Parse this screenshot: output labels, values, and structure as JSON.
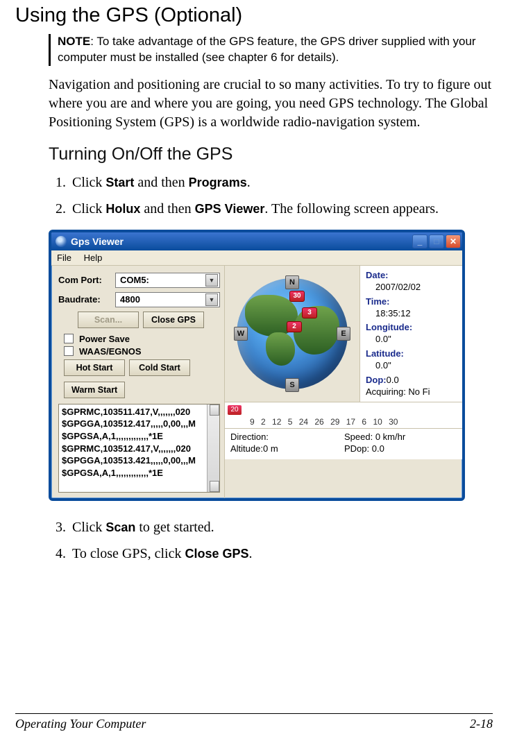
{
  "doc": {
    "h1": "Using the GPS (Optional)",
    "note_label": "NOTE",
    "note_text": ": To take advantage of the GPS feature, the GPS driver supplied with your computer must be installed (see chapter 6 for details).",
    "para1": "Navigation and positioning are crucial to so many activities. To try to figure out where you are and where you are going, you need GPS technology. The Global Positioning System (GPS) is a worldwide radio-navigation system.",
    "h2": "Turning On/Off the GPS",
    "step1_a": "Click ",
    "step1_b": "Start",
    "step1_c": " and then ",
    "step1_d": "Programs",
    "step1_e": ".",
    "step2_a": "Click ",
    "step2_b": "Holux",
    "step2_c": " and then ",
    "step2_d": "GPS Viewer",
    "step2_e": ". The following screen appears.",
    "step3_a": "Click ",
    "step3_b": "Scan",
    "step3_c": " to get started.",
    "step4_a": "To close GPS, click ",
    "step4_b": "Close GPS",
    "step4_c": ".",
    "footer_left": "Operating Your Computer",
    "footer_right": "2-18"
  },
  "app": {
    "title": "Gps Viewer",
    "menu": {
      "file": "File",
      "help": "Help"
    },
    "labels": {
      "comport": "Com Port:",
      "baudrate": "Baudrate:",
      "scan": "Scan...",
      "close_gps": "Close GPS",
      "power_save": "Power Save",
      "waas": "WAAS/EGNOS",
      "hot_start": "Hot Start",
      "cold_start": "Cold Start",
      "warm_start": "Warm Start"
    },
    "values": {
      "comport": "COM5:",
      "baudrate": "4800"
    },
    "compass": {
      "n": "N",
      "s": "S",
      "e": "E",
      "w": "W"
    },
    "sats_on_globe": {
      "s30": "30",
      "s3": "3",
      "s2": "2"
    },
    "info": {
      "date_k": "Date:",
      "date_v": "2007/02/02",
      "time_k": "Time:",
      "time_v": "18:35:12",
      "lon_k": "Longitude:",
      "lon_v": "0.0\"",
      "lat_k": "Latitude:",
      "lat_v": "0.0\"",
      "dop_k": "Dop:",
      "dop_v": "0.0",
      "acq": "Acquiring: No Fi"
    },
    "sat_strip": {
      "badge": "20",
      "nums": "9  2  12  5  24 26 29 17  6  10 30"
    },
    "status": {
      "dir_k": "Direction:",
      "speed_k": "Speed:",
      "speed_v": "0 km/hr",
      "alt_k": "Altitude:",
      "alt_v": "0 m",
      "pdop_k": "PDop:",
      "pdop_v": "0.0"
    },
    "nmea": [
      "$GPRMC,103511.417,V,,,,,,,020",
      "$GPGGA,103512.417,,,,,0,00,,,M",
      "$GPGSA,A,1,,,,,,,,,,,,,*1E",
      "$GPRMC,103512.417,V,,,,,,,020",
      "$GPGGA,103513.421,,,,,0,00,,,M",
      "$GPGSA,A,1,,,,,,,,,,,,,*1E"
    ]
  }
}
